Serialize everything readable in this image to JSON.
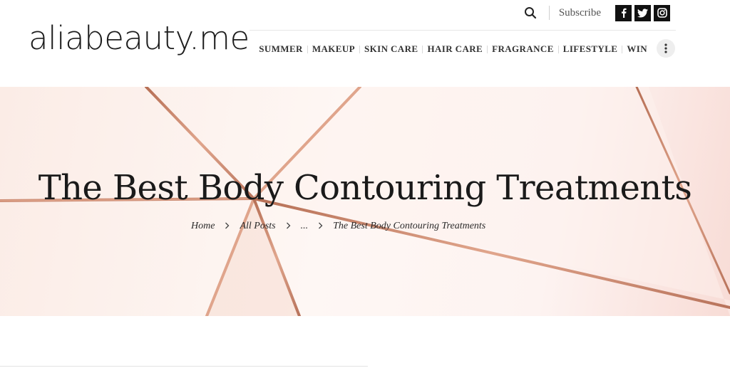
{
  "site": {
    "logo_text": "aliabeauty.me"
  },
  "header": {
    "subscribe_label": "Subscribe",
    "social": [
      {
        "icon": "facebook-icon",
        "glyph": "f"
      },
      {
        "icon": "twitter-icon",
        "glyph": "t"
      },
      {
        "icon": "instagram-icon",
        "glyph": "ig"
      }
    ],
    "nav": [
      "SUMMER",
      "MAKEUP",
      "SKIN CARE",
      "HAIR CARE",
      "FRAGRANCE",
      "LIFESTYLE",
      "WIN"
    ]
  },
  "hero": {
    "title": "The Best Body Contouring Treatments",
    "breadcrumb": {
      "home": "Home",
      "all_posts": "All Posts",
      "ellipsis": "...",
      "current": "The Best Body Contouring Treatments",
      "separator": ">"
    }
  },
  "colors": {
    "accent_copper": "#c98a72",
    "background": "#ffffff",
    "text": "#1a1a1a"
  }
}
